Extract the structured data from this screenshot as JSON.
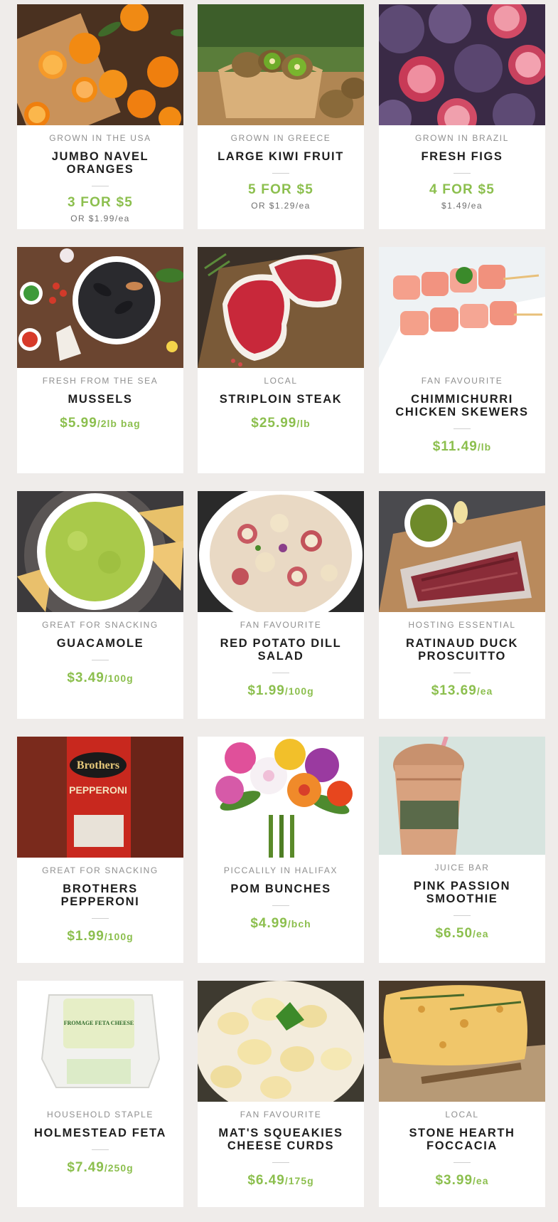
{
  "colors": {
    "page_bg": "#efecea",
    "card_bg": "#ffffff",
    "price_green": "#8cbf4e",
    "title": "#1e1e1e",
    "subtitle": "#8f8f8f"
  },
  "products": [
    {
      "origin": "GROWN IN THE USA",
      "name": "JUMBO NAVEL ORANGES",
      "deal": "3 FOR $5",
      "deal_sub": "OR $1.99/ea",
      "image": "oranges-photo"
    },
    {
      "origin": "GROWN IN GREECE",
      "name": "LARGE KIWI FRUIT",
      "deal": "5 FOR $5",
      "deal_sub": "OR $1.29/ea",
      "image": "kiwi-photo"
    },
    {
      "origin": "GROWN IN BRAZIL",
      "name": "FRESH FIGS",
      "deal": "4 FOR $5",
      "deal_sub": "$1.49/ea",
      "image": "figs-photo"
    },
    {
      "origin": "FRESH FROM THE SEA",
      "name": "MUSSELS",
      "price": "$5.99",
      "unit": "/2lb bag",
      "image": "mussels-photo"
    },
    {
      "origin": "LOCAL",
      "name": "STRIPLOIN STEAK",
      "price": "$25.99",
      "unit": "/lb",
      "image": "steak-photo"
    },
    {
      "origin": "FAN FAVOURITE",
      "name": "CHIMMICHURRI CHICKEN SKEWERS",
      "price": "$11.49",
      "unit": "/lb",
      "image": "chicken-skewers-photo"
    },
    {
      "origin": "GREAT FOR SNACKING",
      "name": "GUACAMOLE",
      "price": "$3.49",
      "unit": "/100g",
      "image": "guacamole-photo"
    },
    {
      "origin": "FAN FAVOURITE",
      "name": "RED POTATO DILL SALAD",
      "price": "$1.99",
      "unit": "/100g",
      "image": "potato-salad-photo"
    },
    {
      "origin": "HOSTING ESSENTIAL",
      "name": "RATINAUD DUCK PROSCUITTO",
      "price": "$13.69",
      "unit": "/ea",
      "image": "duck-proscuitto-photo"
    },
    {
      "origin": "GREAT FOR SNACKING",
      "name": "BROTHERS PEPPERONI",
      "price": "$1.99",
      "unit": "/100g",
      "image": "pepperoni-photo",
      "package_text": "Brothers",
      "package_sub": "PEPPERONI"
    },
    {
      "origin": "PICCALILY IN HALIFAX",
      "name": "POM BUNCHES",
      "price": "$4.99",
      "unit": "/bch",
      "image": "flowers-photo"
    },
    {
      "origin": "JUICE BAR",
      "name": "PINK PASSION SMOOTHIE",
      "price": "$6.50",
      "unit": "/ea",
      "image": "smoothie-photo"
    },
    {
      "origin": "HOUSEHOLD STAPLE",
      "name": "HOLMESTEAD FETA",
      "price": "$7.49",
      "unit": "/250g",
      "image": "feta-photo",
      "package_text": "FROMAGE FETA CHEESE"
    },
    {
      "origin": "FAN FAVOURITE",
      "name": "MAT'S SQUEAKIES CHEESE CURDS",
      "price": "$6.49",
      "unit": "/175g",
      "image": "cheese-curds-photo"
    },
    {
      "origin": "LOCAL",
      "name": "STONE HEARTH FOCCACIA",
      "price": "$3.99",
      "unit": "/ea",
      "image": "foccacia-photo"
    }
  ]
}
